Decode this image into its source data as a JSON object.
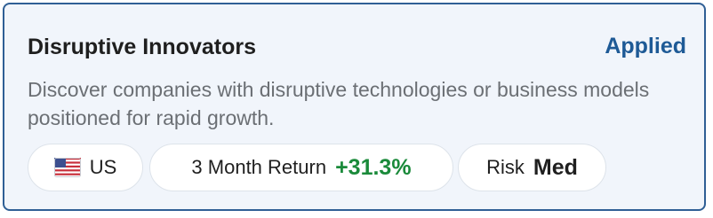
{
  "card": {
    "title": "Disruptive Innovators",
    "status": "Applied",
    "description": "Discover companies with disruptive technologies or business models positioned for rapid growth."
  },
  "tags": {
    "country": {
      "flag_icon": "us-flag-icon",
      "label": "US"
    },
    "return": {
      "label": "3 Month Return",
      "value": "+31.3%"
    },
    "risk": {
      "label": "Risk",
      "value": "Med"
    }
  },
  "colors": {
    "border": "#2f5f95",
    "background": "#f1f5fb",
    "status": "#1e5a96",
    "positive": "#1a8a3a"
  }
}
